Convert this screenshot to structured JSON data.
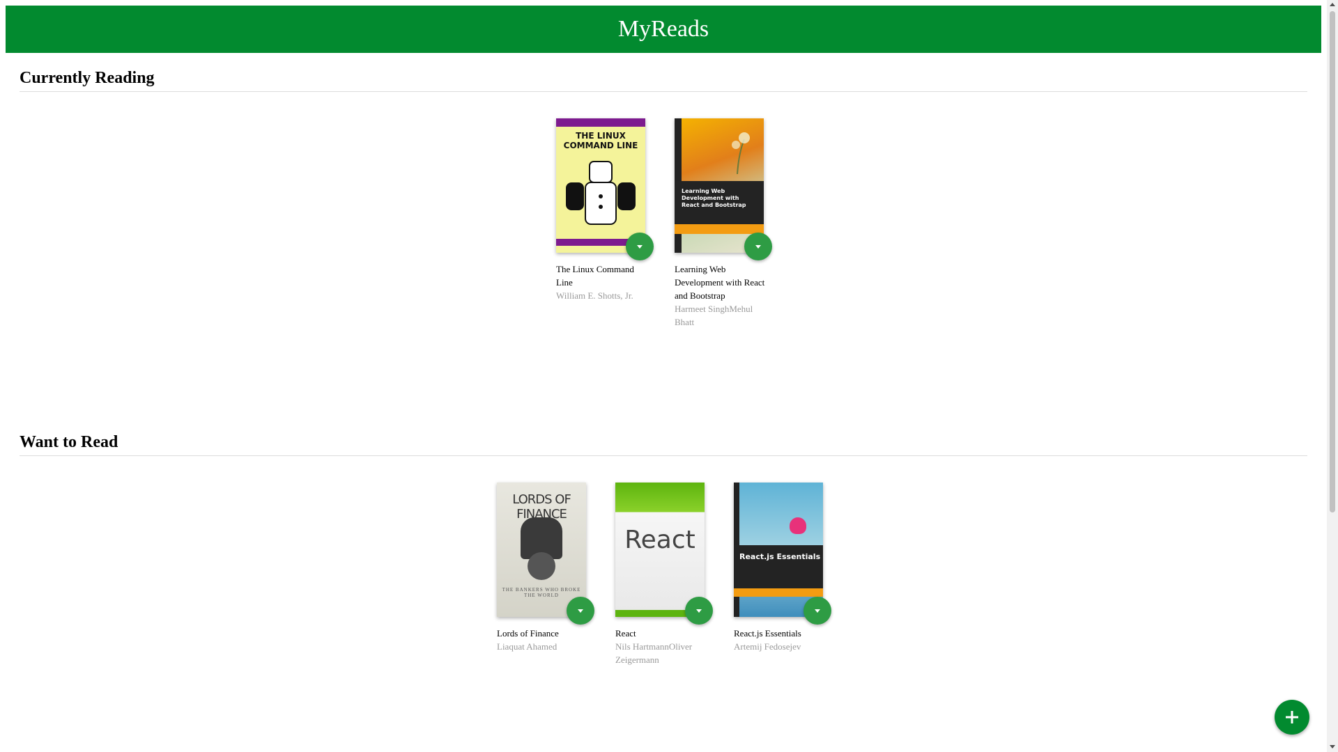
{
  "header": {
    "title": "MyReads"
  },
  "shelves": [
    {
      "title": "Currently Reading",
      "books": [
        {
          "title": "The Linux Command Line",
          "authors": "William E. Shotts, Jr.",
          "cover_text": "THE LINUX COMMAND LINE"
        },
        {
          "title": "Learning Web Development with React and Bootstrap",
          "authors": "Harmeet SinghMehul Bhatt",
          "cover_text": "Learning Web Development with React and Bootstrap"
        }
      ]
    },
    {
      "title": "Want to Read",
      "books": [
        {
          "title": "Lords of Finance",
          "authors": "Liaquat Ahamed",
          "cover_text": "LORDS OF FINANCE",
          "cover_sub": "THE BANKERS WHO BROKE THE WORLD"
        },
        {
          "title": "React",
          "authors": "Nils HartmannOliver Zeigermann",
          "cover_text": "React"
        },
        {
          "title": "React.js Essentials",
          "authors": "Artemij Fedosejev",
          "cover_text": "React.js Essentials"
        }
      ]
    }
  ],
  "icons": {
    "shelf_changer": "caret-down-icon",
    "add": "plus-icon"
  },
  "colors": {
    "header_bg": "#028a2f",
    "changer_bg": "#2e9c44",
    "author_text": "#999999"
  }
}
